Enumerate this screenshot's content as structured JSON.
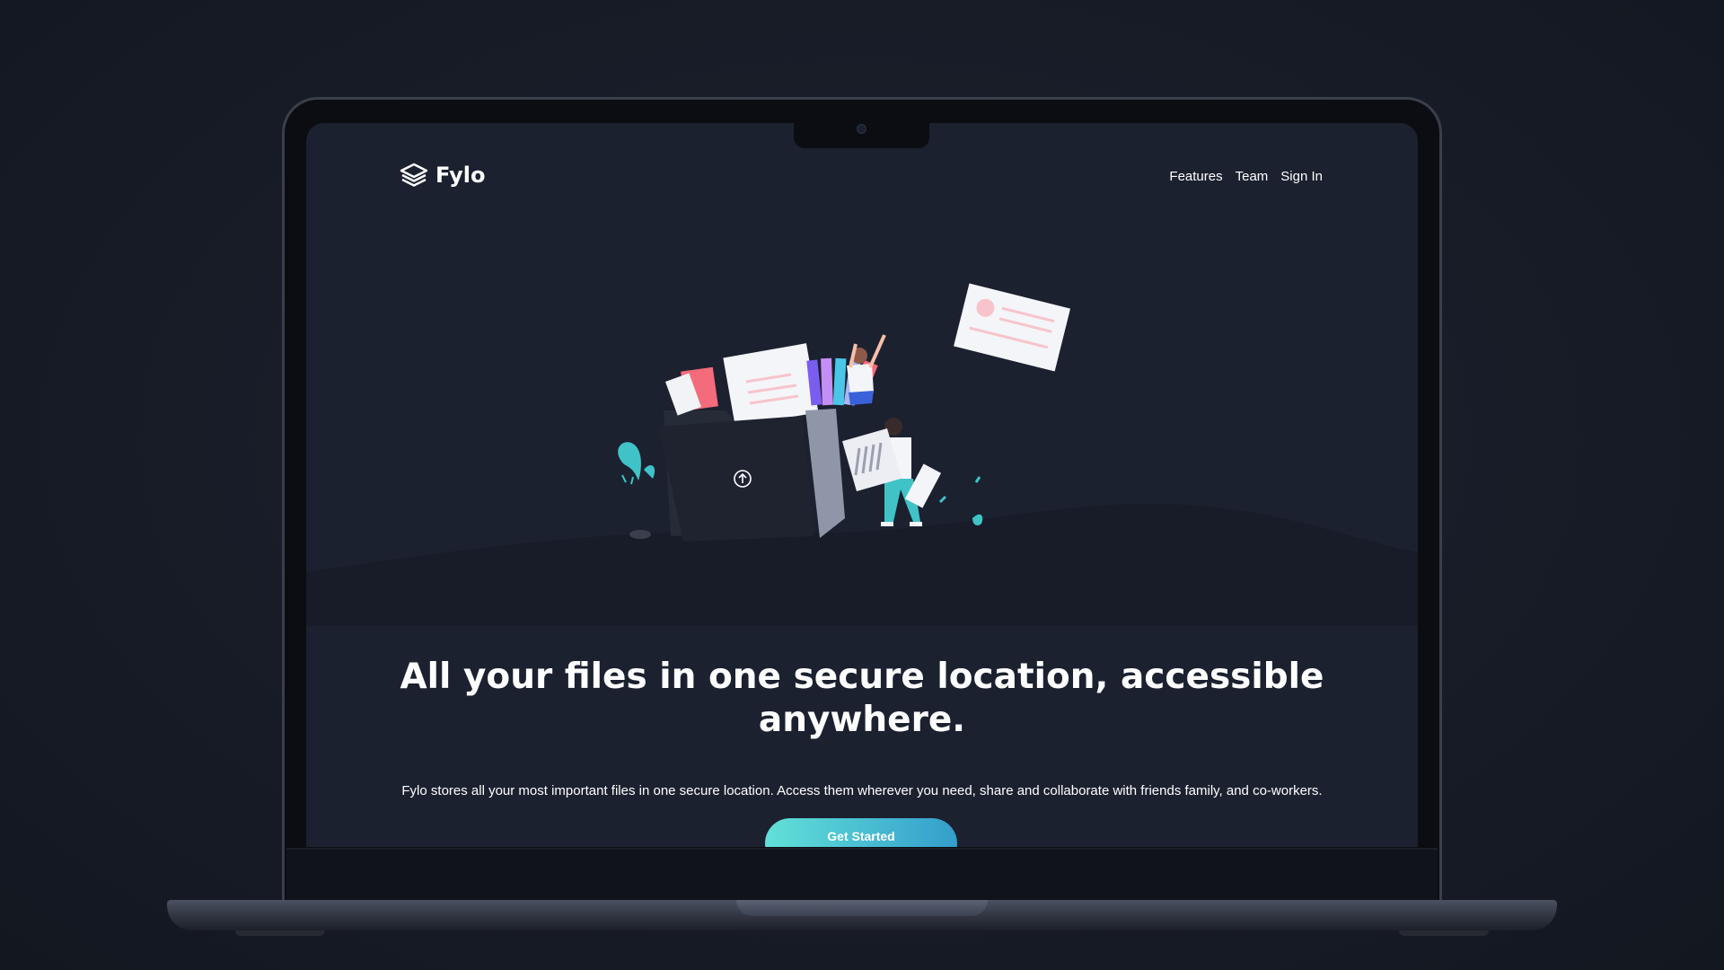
{
  "brand": {
    "name": "Fylo",
    "icon": "layers-icon"
  },
  "nav": {
    "items": [
      {
        "label": "Features"
      },
      {
        "label": "Team"
      },
      {
        "label": "Sign In"
      }
    ]
  },
  "hero": {
    "title_line1": "All your files in one secure location, accessible",
    "title_line2": "anywhere.",
    "description": "Fylo stores all your most important files in one secure location. Access them wherever you need, share and collaborate with friends family, and co-workers.",
    "cta_label": "Get Started",
    "illustration": "people-uploading-files-illustration"
  },
  "colors": {
    "page_bg": "#1c2130",
    "accent_start": "#62e0d8",
    "accent_end": "#339ecc",
    "text": "#ffffff"
  }
}
